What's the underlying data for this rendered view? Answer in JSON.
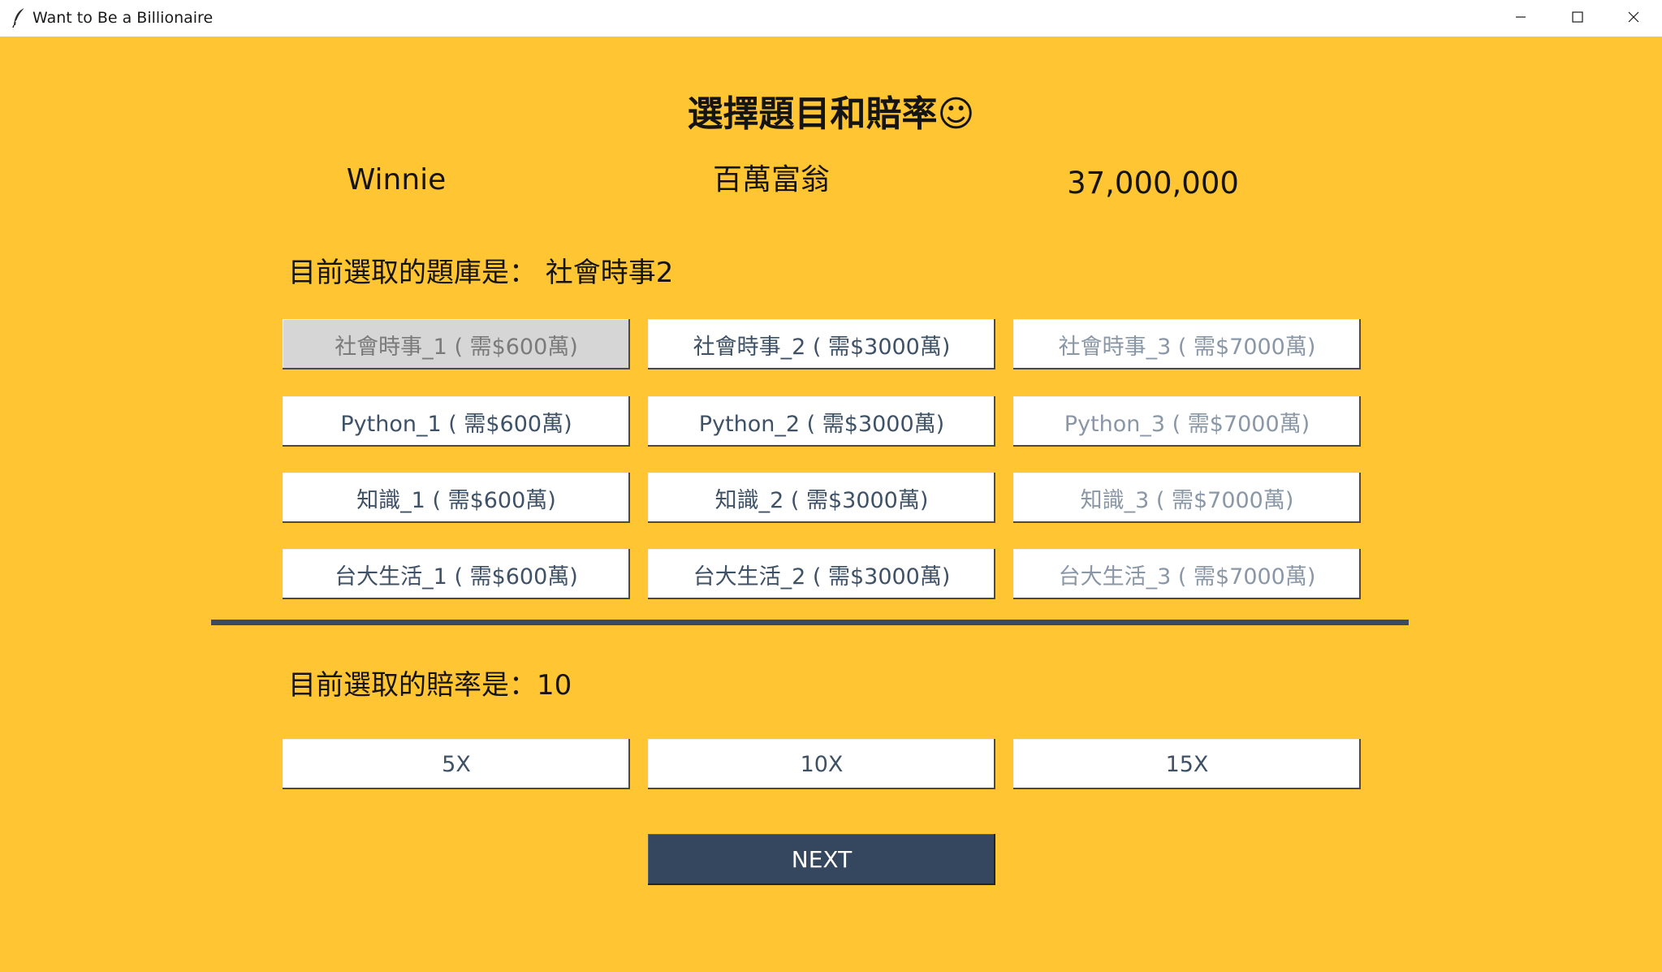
{
  "window": {
    "title": "Want to Be a Billionaire",
    "app_icon": "feather-icon",
    "controls": [
      "minimize-icon",
      "maximize-icon",
      "close-icon"
    ]
  },
  "colors": {
    "background": "#ffc533",
    "button_face": "#ffffff",
    "button_text": "#3e5166",
    "pressed_face": "#d6d6d6",
    "divider": "#3b4a61",
    "next_button": "#34475e"
  },
  "header": {
    "title": "選擇題目和賠率☺"
  },
  "player": {
    "name": "Winnie",
    "status": "百萬富翁",
    "money": "37,000,000"
  },
  "question_bank": {
    "label": "目前選取的題庫是： 社會時事2",
    "buttons": [
      "社會時事_1 ( 需$600萬)",
      "社會時事_2 ( 需$3000萬)",
      "社會時事_3 ( 需$7000萬)",
      "Python_1 ( 需$600萬)",
      "Python_2 ( 需$3000萬)",
      "Python_3 ( 需$7000萬)",
      "知識_1 ( 需$600萬)",
      "知識_2 ( 需$3000萬)",
      "知識_3 ( 需$7000萬)",
      "台大生活_1 ( 需$600萬)",
      "台大生活_2 ( 需$3000萬)",
      "台大生活_3 ( 需$7000萬)"
    ]
  },
  "odds": {
    "label": "目前選取的賠率是：10",
    "buttons": [
      "5X",
      "10X",
      "15X"
    ]
  },
  "next_button": "NEXT"
}
